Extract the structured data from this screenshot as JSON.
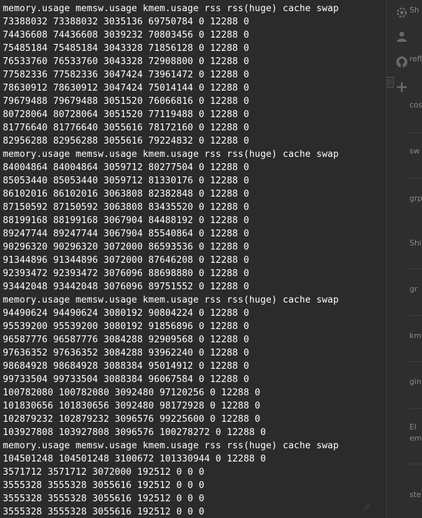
{
  "terminal": {
    "lines": [
      "memory.usage memsw.usage kmem.usage rss rss(huge) cache swap",
      "73388032 73388032 3035136 69750784 0 12288 0",
      "74436608 74436608 3039232 70803456 0 12288 0",
      "75485184 75485184 3043328 71856128 0 12288 0",
      "76533760 76533760 3043328 72908800 0 12288 0",
      "77582336 77582336 3047424 73961472 0 12288 0",
      "78630912 78630912 3047424 75014144 0 12288 0",
      "79679488 79679488 3051520 76066816 0 12288 0",
      "80728064 80728064 3051520 77119488 0 12288 0",
      "81776640 81776640 3055616 78172160 0 12288 0",
      "82956288 82956288 3055616 79224832 0 12288 0",
      "memory.usage memsw.usage kmem.usage rss rss(huge) cache swap",
      "84004864 84004864 3059712 80277504 0 12288 0",
      "85053440 85053440 3059712 81330176 0 12288 0",
      "86102016 86102016 3063808 82382848 0 12288 0",
      "87150592 87150592 3063808 83435520 0 12288 0",
      "88199168 88199168 3067904 84488192 0 12288 0",
      "89247744 89247744 3067904 85540864 0 12288 0",
      "90296320 90296320 3072000 86593536 0 12288 0",
      "91344896 91344896 3072000 87646208 0 12288 0",
      "92393472 92393472 3076096 88698880 0 12288 0",
      "93442048 93442048 3076096 89751552 0 12288 0",
      "memory.usage memsw.usage kmem.usage rss rss(huge) cache swap",
      "94490624 94490624 3080192 90804224 0 12288 0",
      "95539200 95539200 3080192 91856896 0 12288 0",
      "96587776 96587776 3084288 92909568 0 12288 0",
      "97636352 97636352 3084288 93962240 0 12288 0",
      "98684928 98684928 3088384 95014912 0 12288 0",
      "99733504 99733504 3088384 96067584 0 12288 0",
      "100782080 100782080 3092480 97120256 0 12288 0",
      "101830656 101830656 3092480 98172928 0 12288 0",
      "102879232 102879232 3096576 99225600 0 12288 0",
      "103927808 103927808 3096576 100278272 0 12288 0",
      "memory.usage memsw.usage kmem.usage rss rss(huge) cache swap",
      "104501248 104501248 3100672 101330944 0 12288 0",
      "3571712 3571712 3072000 192512 0 0 0",
      "3555328 3555328 3055616 192512 0 0 0",
      "3555328 3555328 3055616 192512 0 0 0",
      "3555328 3555328 3055616 192512 0 0 0"
    ]
  },
  "side_panel": {
    "icons": [
      "gear-icon",
      "user-icon",
      "github-icon",
      "plus-icon",
      "document-icon"
    ],
    "fragments": [
      "Sh",
      "refl",
      "cos",
      "sw",
      "grp",
      "Shi",
      "gr",
      "km",
      "gin",
      "El",
      "emi",
      "ste"
    ]
  }
}
